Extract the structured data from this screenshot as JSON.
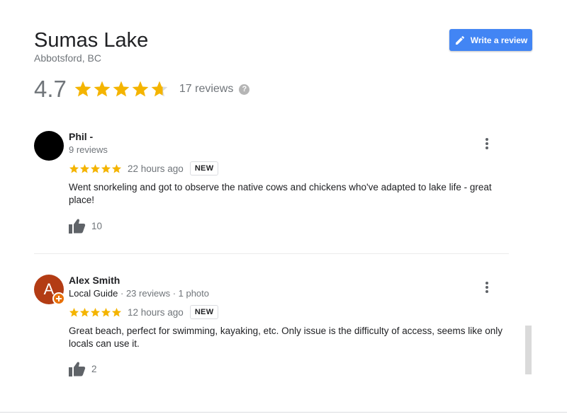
{
  "place": {
    "name": "Sumas Lake",
    "location": "Abbotsford, BC"
  },
  "summary": {
    "rating": "4.7",
    "stars_value": 4.7,
    "reviews_count": "17 reviews",
    "help_glyph": "?"
  },
  "actions": {
    "write_review": "Write a review"
  },
  "colors": {
    "star": "#f4b400",
    "star_empty": "#dadce0",
    "button": "#4285f4",
    "avatar_alex": "#b33c14",
    "guide_badge": "#e8710a"
  },
  "reviews": [
    {
      "name": "Phil -",
      "meta_main": "9 reviews",
      "meta_extra": "",
      "stars": 5,
      "time": "22 hours ago",
      "badge": "NEW",
      "text": "Went snorkeling and got to observe the native cows and chickens who've adapted to lake life - great place!",
      "likes": "10",
      "avatar_icon": "blank-avatar"
    },
    {
      "name": "Alex Smith",
      "meta_main": "Local Guide",
      "meta_extra": " · 23 reviews · 1 photo",
      "stars": 5,
      "time": "12 hours ago",
      "badge": "NEW",
      "text": "Great beach, perfect for swimming, kayaking, etc. Only issue is the difficulty of access, seems like only locals can use it.",
      "likes": "2",
      "avatar_letter": "A",
      "avatar_icon": "local-guide-badge-icon"
    }
  ]
}
